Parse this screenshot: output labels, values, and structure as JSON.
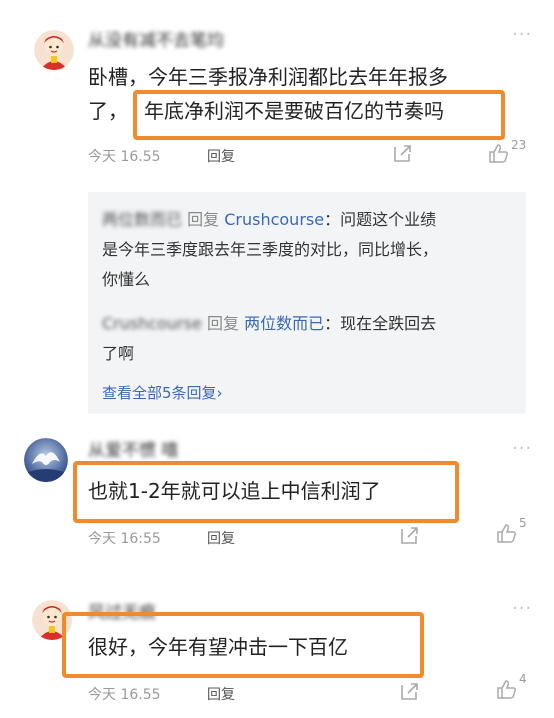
{
  "comments": [
    {
      "username": "从没有减不去笔均",
      "text_line1": "卧槽，今年三季报净利润都比去年年报多",
      "text_line2_prefix": "了，",
      "highlighted": "年底净利润不是要破百亿的节奏吗",
      "time": "今天 16.55",
      "reply_label": "回复",
      "like_count": "23"
    },
    {
      "username": "从爱不惯 嘻",
      "highlighted": "也就1-2年就可以追上中信利润了",
      "time": "今天 16:55",
      "reply_label": "回复",
      "like_count": "5"
    },
    {
      "username": "风过无痕",
      "highlighted": "很好，今年有望冲击一下百亿",
      "time": "今天 16.55",
      "reply_label": "回复",
      "like_count": "4"
    }
  ],
  "replies": {
    "r1_user": "两位数而已",
    "r1_reply_word": "回复",
    "r1_target": "Crushcourse",
    "r1_text1": "问题这个业绩",
    "r1_text2": "是今年三季度跟去年三季度的对比，同比增长，",
    "r1_text3": "你懂么",
    "r2_user": "Crushcourse",
    "r2_reply_word": "回复",
    "r2_target": "两位数而已",
    "r2_text1": "现在全跌回去",
    "r2_text2": "了啊",
    "view_all": "查看全部5条回复",
    "view_all_chevron": "›"
  },
  "more_glyph": "···",
  "colors": {
    "highlight": "#f08a2e",
    "link": "#3a68b8"
  }
}
